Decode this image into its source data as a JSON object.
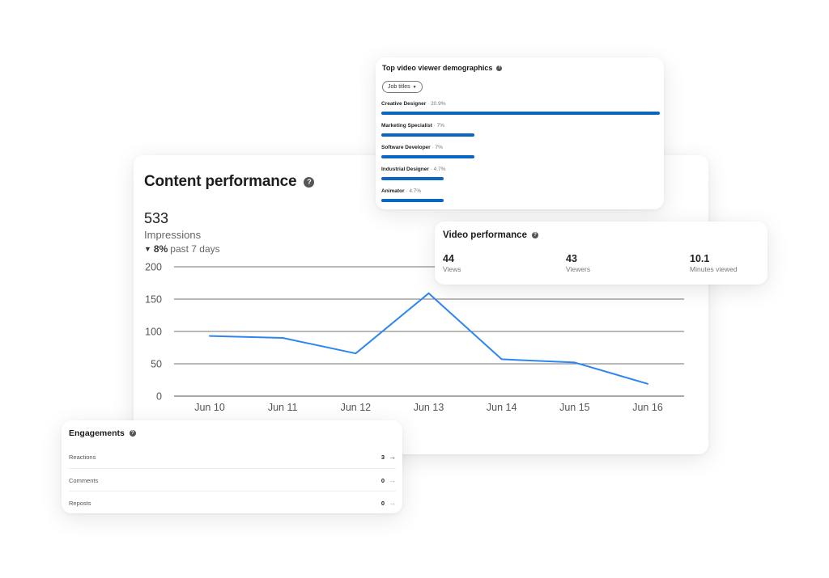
{
  "content_performance": {
    "title": "Content performance",
    "value": "533",
    "label": "Impressions",
    "trend_pct": "8%",
    "trend_label": "past 7 days"
  },
  "chart_data": {
    "type": "line",
    "categories": [
      "Jun 10",
      "Jun 11",
      "Jun 12",
      "Jun 13",
      "Jun 14",
      "Jun 15",
      "Jun 16"
    ],
    "series": [
      {
        "values": [
          93,
          90,
          66,
          159,
          57,
          52,
          19
        ]
      }
    ],
    "yticks": [
      "0",
      "50",
      "100",
      "150",
      "200"
    ],
    "ylim": [
      0,
      200
    ],
    "grid": true,
    "line_color": "#2d86f0"
  },
  "demographics": {
    "title": "Top video viewer demographics",
    "filter_label": "Job titles",
    "bar_color": "#0a66c2",
    "items": [
      {
        "name": "Creative Designer",
        "pct": "20.9%",
        "share": 0.209
      },
      {
        "name": "Marketing Specialist",
        "pct": "7%",
        "share": 0.07
      },
      {
        "name": "Software Developer",
        "pct": "7%",
        "share": 0.07
      },
      {
        "name": "Industrial Designer",
        "pct": "4.7%",
        "share": 0.047
      },
      {
        "name": "Animator",
        "pct": "4.7%",
        "share": 0.047
      }
    ]
  },
  "video_performance": {
    "title": "Video performance",
    "stats": [
      {
        "value": "44",
        "label": "Views"
      },
      {
        "value": "43",
        "label": "Viewers"
      },
      {
        "value": "10.1",
        "label": "Minutes viewed"
      }
    ]
  },
  "engagements": {
    "title": "Engagements",
    "rows": [
      {
        "label": "Reactions",
        "count": "3"
      },
      {
        "label": "Comments",
        "count": "0"
      },
      {
        "label": "Reposts",
        "count": "0"
      }
    ]
  },
  "icons": {
    "help": "help-circle-icon",
    "arrow": "arrow-right-icon",
    "caret": "caret-down-icon",
    "trend": "triangle-down-icon"
  },
  "glyphs": {
    "help": "?",
    "arrow": "→",
    "caret": "▼",
    "trend_down": "▼"
  }
}
